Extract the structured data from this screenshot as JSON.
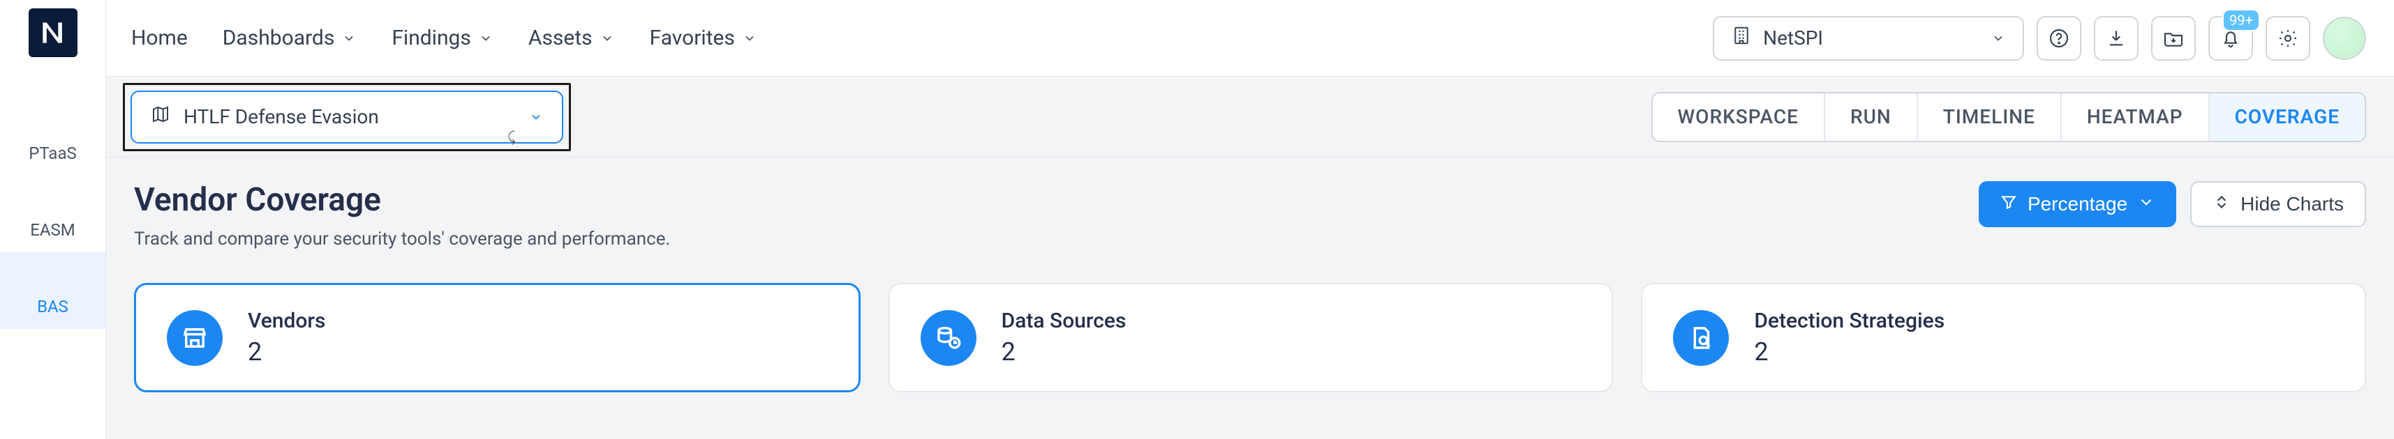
{
  "rail": {
    "items": [
      {
        "label": "PTaaS"
      },
      {
        "label": "EASM"
      },
      {
        "label": "BAS"
      }
    ]
  },
  "nav": {
    "home": "Home",
    "dashboards": "Dashboards",
    "findings": "Findings",
    "assets": "Assets",
    "favorites": "Favorites"
  },
  "org_selector": {
    "label": "NetSPI"
  },
  "notifications": {
    "badge": "99+"
  },
  "module_selector": {
    "value": "HTLF Defense Evasion"
  },
  "view_tabs": {
    "workspace": "WORKSPACE",
    "run": "RUN",
    "timeline": "TIMELINE",
    "heatmap": "HEATMAP",
    "coverage": "COVERAGE"
  },
  "page": {
    "title": "Vendor Coverage",
    "subtitle": "Track and compare your security tools' coverage and performance."
  },
  "actions": {
    "percentage": "Percentage",
    "hide_charts": "Hide Charts"
  },
  "cards": {
    "vendors": {
      "title": "Vendors",
      "value": "2"
    },
    "data_sources": {
      "title": "Data Sources",
      "value": "2"
    },
    "detection_strategies": {
      "title": "Detection Strategies",
      "value": "2"
    }
  }
}
